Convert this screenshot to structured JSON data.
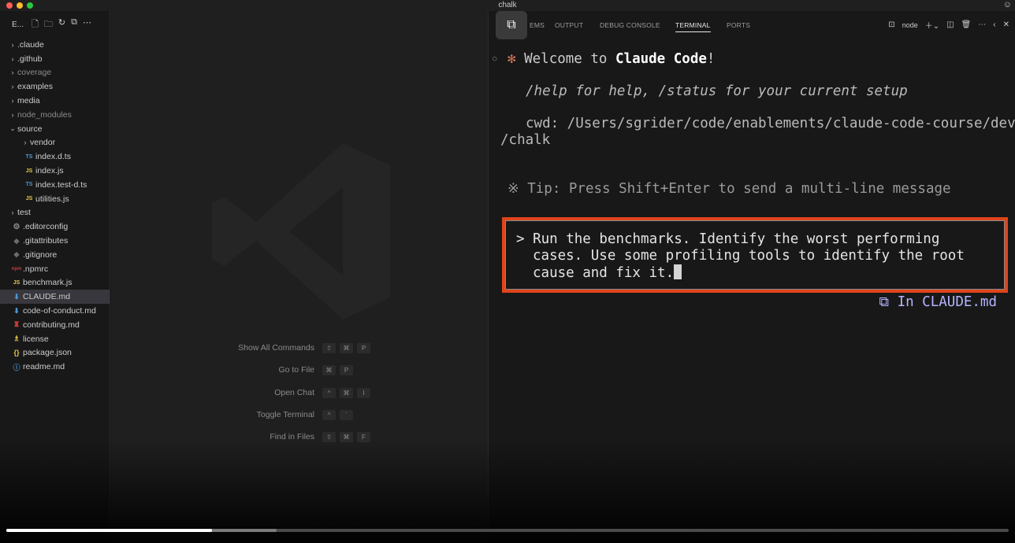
{
  "window": {
    "title": "chalk"
  },
  "sidebar": {
    "header_label": "E...",
    "items": [
      {
        "label": ".claude",
        "kind": "folder",
        "chev": "›",
        "indent": 0,
        "dim": false,
        "icon": ""
      },
      {
        "label": ".github",
        "kind": "folder",
        "chev": "›",
        "indent": 0,
        "dim": false,
        "icon": ""
      },
      {
        "label": "coverage",
        "kind": "folder",
        "chev": "›",
        "indent": 0,
        "dim": true,
        "icon": ""
      },
      {
        "label": "examples",
        "kind": "folder",
        "chev": "›",
        "indent": 0,
        "dim": false,
        "icon": ""
      },
      {
        "label": "media",
        "kind": "folder",
        "chev": "›",
        "indent": 0,
        "dim": false,
        "icon": ""
      },
      {
        "label": "node_modules",
        "kind": "folder",
        "chev": "›",
        "indent": 0,
        "dim": true,
        "icon": ""
      },
      {
        "label": "source",
        "kind": "folder-open",
        "chev": "⌄",
        "indent": 0,
        "dim": false,
        "icon": ""
      },
      {
        "label": "vendor",
        "kind": "folder",
        "chev": "›",
        "indent": 1,
        "dim": false,
        "icon": ""
      },
      {
        "label": "index.d.ts",
        "kind": "file",
        "chev": "",
        "indent": 1,
        "dim": false,
        "icon": "TS"
      },
      {
        "label": "index.js",
        "kind": "file",
        "chev": "",
        "indent": 1,
        "dim": false,
        "icon": "JS"
      },
      {
        "label": "index.test-d.ts",
        "kind": "file",
        "chev": "",
        "indent": 1,
        "dim": false,
        "icon": "TS"
      },
      {
        "label": "utilities.js",
        "kind": "file",
        "chev": "",
        "indent": 1,
        "dim": false,
        "icon": "JS"
      },
      {
        "label": "test",
        "kind": "folder",
        "chev": "›",
        "indent": 0,
        "dim": false,
        "icon": ""
      },
      {
        "label": ".editorconfig",
        "kind": "file",
        "chev": "",
        "indent": 0,
        "dim": false,
        "icon": "⚙"
      },
      {
        "label": ".gitattributes",
        "kind": "file",
        "chev": "",
        "indent": 0,
        "dim": false,
        "icon": "◆"
      },
      {
        "label": ".gitignore",
        "kind": "file",
        "chev": "",
        "indent": 0,
        "dim": false,
        "icon": "◆"
      },
      {
        "label": ".npmrc",
        "kind": "file",
        "chev": "",
        "indent": 0,
        "dim": false,
        "icon": "npm"
      },
      {
        "label": "benchmark.js",
        "kind": "file",
        "chev": "",
        "indent": 0,
        "dim": false,
        "icon": "JS"
      },
      {
        "label": "CLAUDE.md",
        "kind": "file",
        "chev": "",
        "indent": 0,
        "dim": false,
        "icon": "⬇",
        "selected": true
      },
      {
        "label": "code-of-conduct.md",
        "kind": "file",
        "chev": "",
        "indent": 0,
        "dim": false,
        "icon": "⬇"
      },
      {
        "label": "contributing.md",
        "kind": "file",
        "chev": "",
        "indent": 0,
        "dim": false,
        "icon": "♜"
      },
      {
        "label": "license",
        "kind": "file",
        "chev": "",
        "indent": 0,
        "dim": false,
        "icon": "♗"
      },
      {
        "label": "package.json",
        "kind": "file",
        "chev": "",
        "indent": 0,
        "dim": false,
        "icon": "{}"
      },
      {
        "label": "readme.md",
        "kind": "file",
        "chev": "",
        "indent": 0,
        "dim": false,
        "icon": "ⓘ"
      }
    ]
  },
  "editor": {
    "shortcuts": [
      {
        "label": "Show All Commands",
        "keys": [
          "⇧",
          "⌘",
          "P"
        ]
      },
      {
        "label": "Go to File",
        "keys": [
          "⌘",
          "P"
        ]
      },
      {
        "label": "Open Chat",
        "keys": [
          "^",
          "⌘",
          "I"
        ]
      },
      {
        "label": "Toggle Terminal",
        "keys": [
          "^",
          "`"
        ]
      },
      {
        "label": "Find in Files",
        "keys": [
          "⇧",
          "⌘",
          "F"
        ]
      }
    ]
  },
  "panel": {
    "tabs": [
      "EMS",
      "OUTPUT",
      "DEBUG CONSOLE",
      "TERMINAL",
      "PORTS"
    ],
    "active_tab": "TERMINAL",
    "terminal_name": "node"
  },
  "terminal": {
    "welcome_prefix": "Welcome to ",
    "welcome_bold": "Claude Code",
    "welcome_suffix": "!",
    "help_line": "/help for help, /status for your current setup",
    "cwd_line1": "cwd: /Users/sgrider/code/enablements/claude-code-course/dev",
    "cwd_line2": "/chalk",
    "tip_line": "Tip: Press Shift+Enter to send a multi-line message",
    "prompt_symbol": ">",
    "prompt_line1": "Run the benchmarks. Identify the worst performing",
    "prompt_line2": "cases. Use some profiling tools to identify the root",
    "prompt_line3": "cause and fix it.",
    "memory_hint": "In CLAUDE.md"
  },
  "video": {
    "progress": 0.205,
    "buffered": 0.27
  },
  "colors": {
    "accent_orange": "#e0441b",
    "claude_star": "#d97757",
    "memory_hint": "#b4b4ff"
  }
}
